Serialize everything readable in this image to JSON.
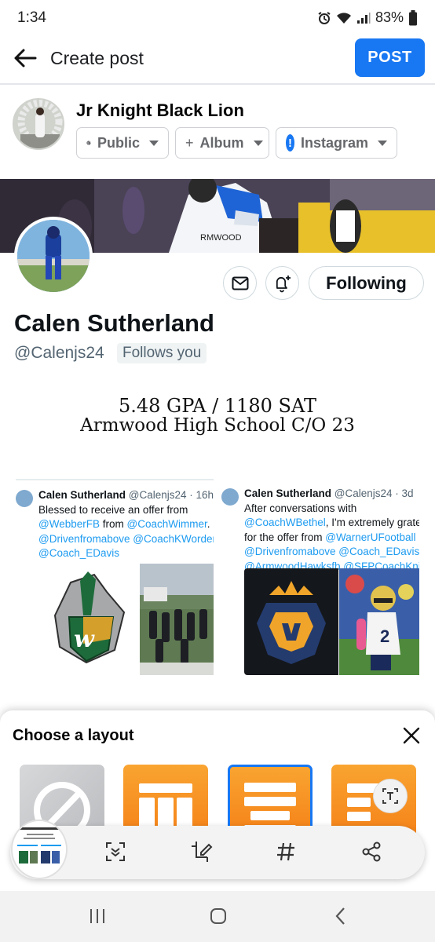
{
  "status_bar": {
    "time": "1:34",
    "battery": "83%"
  },
  "header": {
    "title": "Create post",
    "post_label": "POST"
  },
  "author": {
    "name": "Jr Knight Black Lion",
    "audience_label": "Public",
    "album_label": "Album",
    "album_prefix": "+",
    "share_label": "Instagram",
    "share_badge": "!"
  },
  "profile": {
    "name": "Calen Sutherland",
    "handle": "@Calenjs24",
    "follows_badge": "Follows you",
    "following_label": "Following",
    "bio_line1": "5.48 GPA / 1180 SAT",
    "bio_line2": "Armwood High School C/O 23"
  },
  "tweets": [
    {
      "name": "Calen Sutherland",
      "meta": "@Calenjs24 · 16h",
      "line1": "Blessed to receive an offer from",
      "line2_link1": "@WebberFB",
      "line2_mid": " from ",
      "line2_link2": "@CoachWimmer",
      "line2_end": ".",
      "line3": "@Drivenfromabove @CoachKWorden",
      "line4": "@Coach_EDavis"
    },
    {
      "name": "Calen Sutherland",
      "meta": "@Calenjs24 · 3d",
      "line1": "After conversations with",
      "line2_link": "@CoachWBethel",
      "line2_end": ", I'm extremely grateful",
      "line3_start": "for the offer from ",
      "line3_link": "@WarnerUFootball",
      "line4": "@Drivenfromabove @Coach_EDavis",
      "line5": "@ArmwoodHawksfb @SFPCoachKnight"
    }
  ],
  "layout_sheet": {
    "title": "Choose a layout"
  },
  "icons": {
    "back": "arrow-left-icon",
    "globe": "globe-icon",
    "mail": "mail-icon",
    "bell": "bell-plus-icon",
    "close": "close-icon",
    "text_extract": "text-extract-icon",
    "scroll_capture": "scroll-capture-icon",
    "edit": "crop-edit-icon",
    "hashtag": "hashtag-icon",
    "share": "share-icon"
  },
  "colors": {
    "primary": "#1877f2",
    "link": "#1d9bf0",
    "orange": "#f79a24"
  }
}
